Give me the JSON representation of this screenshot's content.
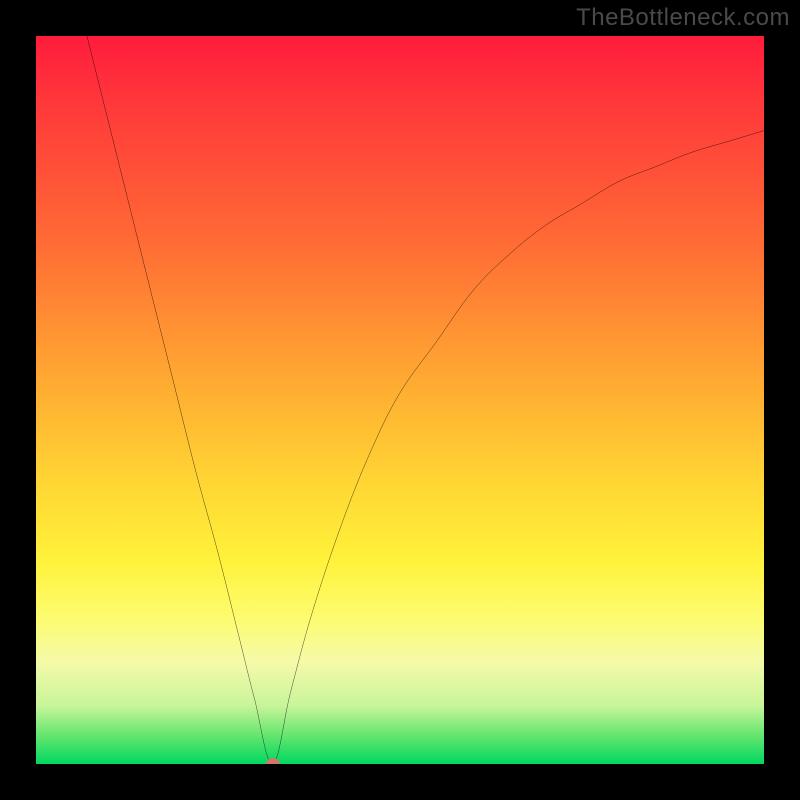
{
  "watermark": "TheBottleneck.com",
  "chart_data": {
    "type": "line",
    "title": "",
    "xlabel": "",
    "ylabel": "",
    "xlim": [
      0,
      100
    ],
    "ylim": [
      0,
      100
    ],
    "grid": false,
    "legend": false,
    "vertex": {
      "x": 32.5,
      "y": 0,
      "color": "#cc7a6b"
    },
    "series": [
      {
        "name": "bottleneck-curve",
        "color": "#000000",
        "x": [
          7,
          10,
          13,
          16,
          19,
          22,
          25,
          28,
          30,
          32.5,
          35,
          38,
          42,
          46,
          50,
          55,
          60,
          65,
          70,
          75,
          80,
          85,
          90,
          95,
          100
        ],
        "y": [
          100,
          88,
          76,
          64,
          52,
          40,
          29,
          17,
          9,
          0,
          10,
          21,
          33,
          43,
          51,
          58,
          65,
          70,
          74,
          77,
          80,
          82,
          84,
          85.5,
          87
        ]
      }
    ],
    "background_gradient": {
      "type": "vertical",
      "stops": [
        {
          "pos": 0,
          "color": "#ff1c3c"
        },
        {
          "pos": 10,
          "color": "#ff3a3a"
        },
        {
          "pos": 28,
          "color": "#ff6a35"
        },
        {
          "pos": 45,
          "color": "#ffa232"
        },
        {
          "pos": 60,
          "color": "#ffd233"
        },
        {
          "pos": 72,
          "color": "#fff23a"
        },
        {
          "pos": 80,
          "color": "#fdfc70"
        },
        {
          "pos": 86,
          "color": "#f5faa8"
        },
        {
          "pos": 92,
          "color": "#c8f59a"
        },
        {
          "pos": 96,
          "color": "#66e66f"
        },
        {
          "pos": 100,
          "color": "#00d860"
        }
      ]
    }
  }
}
